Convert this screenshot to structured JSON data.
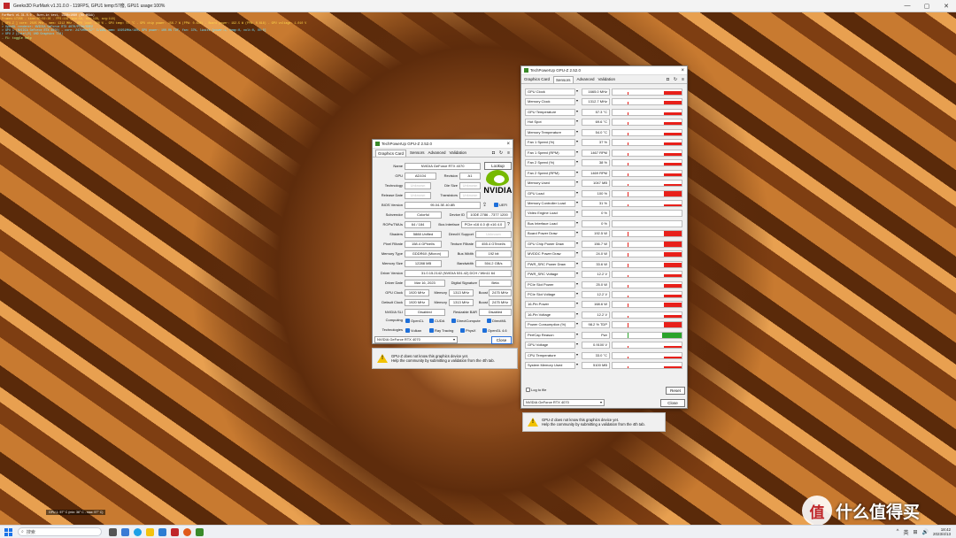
{
  "app_window": {
    "title": "Geeks3D FurMark v1.31.0.0 - 119FPS, GPU1 temp:57癈, GPU1 usage:100%",
    "controls": [
      "—",
      "▢",
      "✕"
    ]
  },
  "osd": {
    "lines": [
      "FurMark v1.31.0.0 - Burn-in test, 1920x1080 (0X MSAA)",
      "Frames:17266 - time:00:02:26 - FPS:119 (min:59, max:129, avg:118)",
      "[ GPU-Z ] core: 2505 MHz - mem: 1312 MHz - GPU load: 100 % - GPU temp: 57 °C - GPU chip power: 156.7 W (PPW: 0.648) - Board power: 192.5 W (PPW: 0.618) - GPU voltage: 1.010 V",
      "> OpenGL renderer: NVIDIA GeForce RTX 4070/PCIe/SSE2",
      "> GPU 1 (NVIDIA GeForce RTX 4070) - core: 2475MHz/57° C/99%, mem: 10251MHz/16%, GPU power: 100.0% TDP, fan: 37%, limits:[power:1, temp:0, volt:0, OV:0]",
      "> GPU 2 (Intel(R) UHD Graphics 770)",
      "- F1: toggle help"
    ],
    "footer": "GPU 1: 57° C (min: 36° C - max: 57° C)"
  },
  "gpuz_left": {
    "title": "TechPowerUp GPU-Z 2.52.0",
    "tabs": [
      "Graphics Card",
      "Sensors",
      "Advanced",
      "Validation"
    ],
    "tab_icons": [
      "camera-icon",
      "refresh-icon",
      "menu-icon"
    ],
    "lookup": "Lookup",
    "uefi": "UEFI",
    "logo_text": "NVIDIA",
    "rows": {
      "name": {
        "label": "Name",
        "value": "NVIDIA GeForce RTX 4070"
      },
      "gpu": {
        "label": "GPU",
        "value": "AD104"
      },
      "revision": {
        "label": "Revision",
        "value": "A1"
      },
      "technology": {
        "label": "Technology",
        "value": "Unknown"
      },
      "die_size": {
        "label": "Die Size",
        "value": "Unknown"
      },
      "release_date": {
        "label": "Release Date",
        "value": "Unknown"
      },
      "transistors": {
        "label": "Transistors",
        "value": "Unknown"
      },
      "bios": {
        "label": "BIOS Version",
        "value": "95.04.3E.40.8B"
      },
      "subvendor": {
        "label": "Subvendor",
        "value": "Colorful"
      },
      "device_id": {
        "label": "Device ID",
        "value": "10DE 2786 - 7377 1200"
      },
      "rops": {
        "label": "ROPs/TMUs",
        "value": "64 / 184"
      },
      "bus": {
        "label": "Bus Interface",
        "value": "PCIe x16 4.0 @ x16 4.0",
        "help": "?"
      },
      "shaders": {
        "label": "Shaders",
        "value": "5888 Unified"
      },
      "directx": {
        "label": "DirectX Support",
        "value": "Unknown"
      },
      "pixel": {
        "label": "Pixel Fillrate",
        "value": "158.4 GPixel/s"
      },
      "texture": {
        "label": "Texture Fillrate",
        "value": "455.4 GTexel/s"
      },
      "memtype": {
        "label": "Memory Type",
        "value": "GDDR6X (Micron)"
      },
      "buswidth": {
        "label": "Bus Width",
        "value": "192 bit"
      },
      "memsize": {
        "label": "Memory Size",
        "value": "12288 MB"
      },
      "bandwidth": {
        "label": "Bandwidth",
        "value": "504.2 GB/s"
      },
      "driver": {
        "label": "Driver Version",
        "value": "31.0.15.2142 (NVIDIA 531.42) DCH / Win11 64"
      },
      "driverdate": {
        "label": "Driver Date",
        "value": "Mar 16, 2023"
      },
      "signature": {
        "label": "Digital Signature",
        "value": "Beta"
      },
      "gpuclock": {
        "label": "GPU Clock",
        "value": "1920 MHz",
        "mem_label": "Memory",
        "mem": "1313 MHz",
        "boost_label": "Boost",
        "boost": "2475 MHz"
      },
      "defclock": {
        "label": "Default Clock",
        "value": "1920 MHz",
        "mem_label": "Memory",
        "mem": "1313 MHz",
        "boost_label": "Boost",
        "boost": "2475 MHz"
      },
      "sli": {
        "label": "NVIDIA SLI",
        "value": "Disabled",
        "rebar_label": "Resizable BAR",
        "rebar": "Disabled"
      },
      "computing": {
        "label": "Computing",
        "items": [
          "OpenCL",
          "CUDA",
          "DirectCompute",
          "DirectML"
        ]
      },
      "technologies": {
        "label": "Technologies",
        "items": [
          "Vulkan",
          "Ray Tracing",
          "PhysX",
          "OpenGL 4.6"
        ]
      }
    },
    "select": "NVIDIA GeForce RTX 4070",
    "close": "Close",
    "warning": [
      "GPU-Z does not know this graphics device yet.",
      "Help the community by submitting a validation from the 4th tab."
    ]
  },
  "gpuz_right": {
    "title": "TechPowerUp GPU-Z 2.52.0",
    "tabs": [
      "Graphics Card",
      "Sensors",
      "Advanced",
      "Validation"
    ],
    "sensors": [
      {
        "name": "GPU Clock",
        "value": "1665.0 MHz",
        "level": 0.5
      },
      {
        "name": "Memory Clock",
        "value": "1312.7 MHz",
        "level": 0.5
      },
      {
        "name": "GPU Temperature",
        "value": "57.3 °C",
        "level": 0.45
      },
      {
        "name": "Hot Spot",
        "value": "69.6 °C",
        "level": 0.45
      },
      {
        "name": "Memory Temperature",
        "value": "54.0 °C",
        "level": 0.45
      },
      {
        "name": "Fan 1 Speed (%)",
        "value": "37 %",
        "level": 0.45
      },
      {
        "name": "Fan 1 Speed (RPM)",
        "value": "1467 RPM",
        "level": 0.45
      },
      {
        "name": "Fan 2 Speed (%)",
        "value": "38 %",
        "level": 0.45
      },
      {
        "name": "Fan 2 Speed (RPM)",
        "value": "1469 RPM",
        "level": 0.45
      },
      {
        "name": "Memory Used",
        "value": "1047 MB",
        "level": 0.35
      },
      {
        "name": "GPU Load",
        "value": "100 %",
        "level": 0.9
      },
      {
        "name": "Memory Controller Load",
        "value": "31 %",
        "level": 0.3
      },
      {
        "name": "Video Engine Load",
        "value": "0 %",
        "level": 0
      },
      {
        "name": "Bus Interface Load",
        "value": "0 %",
        "level": 0
      },
      {
        "name": "Board Power Draw",
        "value": "192.5 W",
        "level": 0.85
      },
      {
        "name": "GPU Chip Power Draw",
        "value": "156.7 W",
        "level": 0.85
      },
      {
        "name": "MVDDC Power Draw",
        "value": "24.0 W",
        "level": 0.7
      },
      {
        "name": "PWR_SRC Power Draw",
        "value": "33.6 W",
        "level": 0.7
      },
      {
        "name": "PWR_SRC Voltage",
        "value": "12.2 V",
        "level": 0.4
      },
      {
        "name": "PCIe Slot Power",
        "value": "25.0 W",
        "level": 0.5
      },
      {
        "name": "PCIe Slot Voltage",
        "value": "12.2 V",
        "level": 0.4
      },
      {
        "name": "16-Pin Power",
        "value": "168.6 W",
        "level": 0.7
      },
      {
        "name": "16-Pin Voltage",
        "value": "12.2 V",
        "level": 0.4
      },
      {
        "name": "Power Consumption (%)",
        "value": "98.2 % TDP",
        "level": 0.8
      },
      {
        "name": "PerfCap Reason",
        "value": "Pwr",
        "level": 1,
        "green": true
      },
      {
        "name": "GPU Voltage",
        "value": "0.9100 V",
        "level": 0.3
      },
      {
        "name": "CPU Temperature",
        "value": "33.0 °C",
        "level": 0.3
      },
      {
        "name": "System Memory Used",
        "value": "5100 MB",
        "level": 0.3
      }
    ],
    "log_to_file": "Log to file",
    "reset": "Reset",
    "select": "NVIDIA GeForce RTX 4070",
    "close": "Close",
    "warning": [
      "GPU-Z does not know this graphics device yet.",
      "Help the community by submitting a validation from the 4th tab."
    ]
  },
  "watermark": {
    "seal": "值",
    "text": "什么值得买"
  },
  "taskbar": {
    "search_placeholder": "搜索",
    "tray_icons": [
      "^",
      "英",
      "⊞",
      "🔊"
    ],
    "time": "18:42",
    "date": "2023/4/13"
  },
  "colors": {
    "sensor_bar": "#e8201a",
    "perfcap": "#2aa32a",
    "accent": "#1e6fd9",
    "nvidia": "#76b900"
  }
}
